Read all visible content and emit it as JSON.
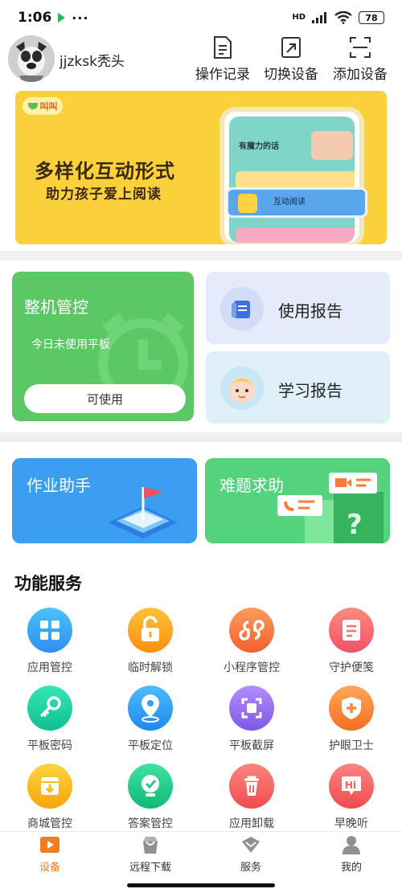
{
  "status_bar": {
    "time": "1:06",
    "more": "···",
    "network": "HD",
    "battery": "78"
  },
  "header": {
    "username": "jjzksk秃头",
    "actions": [
      {
        "label": "操作记录",
        "icon": "document-icon"
      },
      {
        "label": "切换设备",
        "icon": "switch-arrow-icon"
      },
      {
        "label": "添加设备",
        "icon": "scan-icon"
      }
    ]
  },
  "banner": {
    "logo_text": "叫叫",
    "title": "多样化互动形式",
    "subtitle": "助力孩子爱上阅读",
    "phone_title": "有魔力的话",
    "phone_card": "互动阅读"
  },
  "control": {
    "title": "整机管控",
    "status": "今日未使用平板",
    "button": "可使用"
  },
  "reports": [
    {
      "label": "使用报告",
      "icon": "report-doc-icon"
    },
    {
      "label": "学习报告",
      "icon": "student-avatar-icon"
    }
  ],
  "helpers": [
    {
      "label": "作业助手"
    },
    {
      "label": "难题求助"
    }
  ],
  "services": {
    "title": "功能服务",
    "items": [
      {
        "label": "应用管控",
        "icon": "app-grid-icon",
        "color": "#2fa7f1"
      },
      {
        "label": "临时解锁",
        "icon": "unlock-icon",
        "color": "#fba41c"
      },
      {
        "label": "小程序管控",
        "icon": "mini-program-icon",
        "color": "#f97840"
      },
      {
        "label": "守护便笺",
        "icon": "note-icon",
        "color": "#f66c72"
      },
      {
        "label": "平板密码",
        "icon": "key-icon",
        "color": "#1ed4a6"
      },
      {
        "label": "平板定位",
        "icon": "location-pin-icon",
        "color": "#2fa2f4"
      },
      {
        "label": "平板截屏",
        "icon": "screenshot-icon",
        "color": "#9b75ee"
      },
      {
        "label": "护眼卫士",
        "icon": "shield-plus-icon",
        "color": "#f8883a"
      },
      {
        "label": "商城管控",
        "icon": "store-download-icon",
        "color": "#fbbd14"
      },
      {
        "label": "答案管控",
        "icon": "check-badge-icon",
        "color": "#22cc8a"
      },
      {
        "label": "应用卸载",
        "icon": "trash-icon",
        "color": "#f7605e"
      },
      {
        "label": "早晚听",
        "icon": "hi-bubble-icon",
        "color": "#f7605e"
      }
    ]
  },
  "tabbar": {
    "tabs": [
      {
        "label": "设备",
        "active": true,
        "icon": "device-tab-icon"
      },
      {
        "label": "远程下载",
        "active": false,
        "icon": "bag-tab-icon"
      },
      {
        "label": "服务",
        "active": false,
        "icon": "service-tab-icon"
      },
      {
        "label": "我的",
        "active": false,
        "icon": "person-tab-icon"
      }
    ]
  }
}
